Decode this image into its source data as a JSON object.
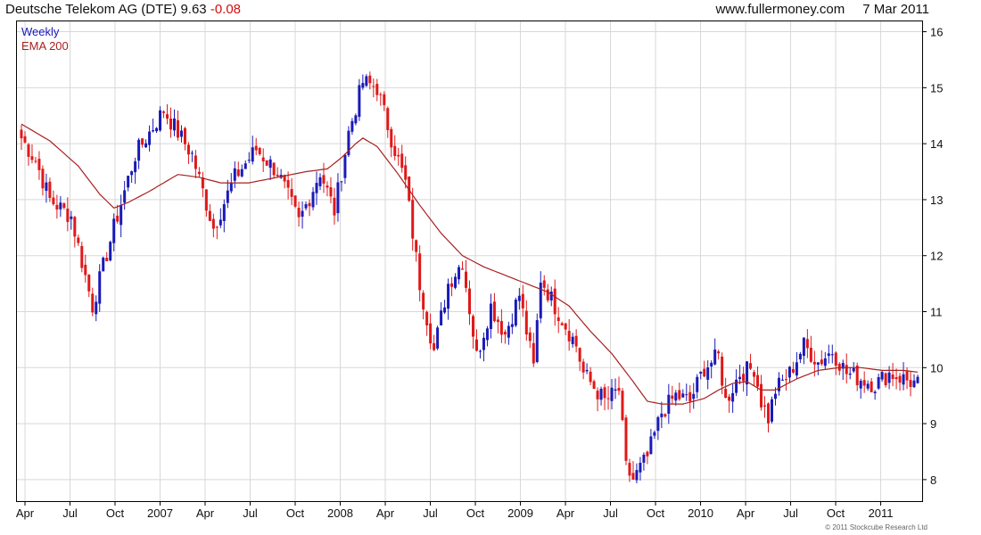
{
  "header": {
    "title_main": "Deutsche Telekom AG (DTE) 9.63",
    "title_change": "-0.08",
    "site": "www.fullermoney.com",
    "date": "7 Mar 2011"
  },
  "legend": {
    "series1": "Weekly",
    "series2": "EMA 200"
  },
  "footer": {
    "copyright": "© 2011 Stockcube Research Ltd"
  },
  "colors": {
    "up": "#1a1ab8",
    "down": "#e01818",
    "ema": "#a82020",
    "grid": "#d8d8d8"
  },
  "chart_data": {
    "type": "candlestick",
    "xlabels": [
      "Apr",
      "Jul",
      "Oct",
      "2007",
      "Apr",
      "Jul",
      "Oct",
      "2008",
      "Apr",
      "Jul",
      "Oct",
      "2009",
      "Apr",
      "Jul",
      "Oct",
      "2010",
      "Apr",
      "Jul",
      "Oct",
      "2011"
    ],
    "yticks": [
      8,
      9,
      10,
      11,
      12,
      13,
      14,
      15,
      16
    ],
    "ylim": [
      7.6,
      16.2
    ],
    "grid": true,
    "legend_position": "top-left",
    "series": [
      {
        "name": "Weekly",
        "type": "candlestick",
        "close_points": [
          [
            0,
            14.1
          ],
          [
            4,
            13.7
          ],
          [
            8,
            13.0
          ],
          [
            14,
            12.7
          ],
          [
            20,
            11.1
          ],
          [
            26,
            12.5
          ],
          [
            32,
            13.8
          ],
          [
            40,
            14.6
          ],
          [
            48,
            13.8
          ],
          [
            54,
            12.5
          ],
          [
            60,
            13.4
          ],
          [
            66,
            13.9
          ],
          [
            72,
            13.5
          ],
          [
            78,
            12.6
          ],
          [
            84,
            13.5
          ],
          [
            88,
            12.8
          ],
          [
            92,
            14.2
          ],
          [
            96,
            15.1
          ],
          [
            100,
            15.0
          ],
          [
            104,
            14.1
          ],
          [
            108,
            13.3
          ],
          [
            112,
            11.5
          ],
          [
            116,
            10.3
          ],
          [
            120,
            11.5
          ],
          [
            124,
            11.9
          ],
          [
            128,
            10.2
          ],
          [
            132,
            11.1
          ],
          [
            136,
            10.6
          ],
          [
            140,
            11.3
          ],
          [
            144,
            10.0
          ],
          [
            146,
            11.6
          ],
          [
            150,
            11.1
          ],
          [
            156,
            10.4
          ],
          [
            158,
            9.9
          ],
          [
            164,
            9.4
          ],
          [
            168,
            9.6
          ],
          [
            170,
            8.2
          ],
          [
            172,
            8.0
          ],
          [
            176,
            8.4
          ],
          [
            180,
            9.2
          ],
          [
            184,
            9.5
          ],
          [
            188,
            9.4
          ],
          [
            192,
            10.0
          ],
          [
            196,
            10.2
          ],
          [
            198,
            9.4
          ],
          [
            202,
            9.9
          ],
          [
            206,
            10.0
          ],
          [
            208,
            9.4
          ],
          [
            210,
            9.1
          ],
          [
            212,
            9.6
          ],
          [
            216,
            9.9
          ],
          [
            220,
            10.4
          ],
          [
            224,
            10.1
          ],
          [
            228,
            10.3
          ],
          [
            232,
            9.9
          ],
          [
            236,
            9.8
          ],
          [
            240,
            9.7
          ],
          [
            244,
            9.9
          ],
          [
            248,
            9.8
          ],
          [
            252,
            9.7
          ]
        ],
        "note": "close_points = [week index, approx close]"
      },
      {
        "name": "EMA 200",
        "type": "line",
        "points": [
          [
            0,
            14.35
          ],
          [
            8,
            14.05
          ],
          [
            16,
            13.6
          ],
          [
            22,
            13.1
          ],
          [
            26,
            12.85
          ],
          [
            30,
            12.95
          ],
          [
            36,
            13.15
          ],
          [
            44,
            13.45
          ],
          [
            50,
            13.4
          ],
          [
            56,
            13.3
          ],
          [
            64,
            13.3
          ],
          [
            72,
            13.4
          ],
          [
            80,
            13.5
          ],
          [
            86,
            13.55
          ],
          [
            90,
            13.75
          ],
          [
            94,
            14.0
          ],
          [
            96,
            14.1
          ],
          [
            100,
            13.95
          ],
          [
            106,
            13.45
          ],
          [
            112,
            12.9
          ],
          [
            118,
            12.4
          ],
          [
            124,
            12.0
          ],
          [
            130,
            11.8
          ],
          [
            136,
            11.65
          ],
          [
            142,
            11.5
          ],
          [
            148,
            11.35
          ],
          [
            154,
            11.1
          ],
          [
            160,
            10.65
          ],
          [
            166,
            10.25
          ],
          [
            172,
            9.75
          ],
          [
            176,
            9.4
          ],
          [
            180,
            9.35
          ],
          [
            186,
            9.35
          ],
          [
            192,
            9.45
          ],
          [
            196,
            9.6
          ],
          [
            200,
            9.72
          ],
          [
            204,
            9.75
          ],
          [
            208,
            9.6
          ],
          [
            212,
            9.6
          ],
          [
            218,
            9.8
          ],
          [
            224,
            9.95
          ],
          [
            230,
            10.0
          ],
          [
            236,
            10.0
          ],
          [
            242,
            9.95
          ],
          [
            248,
            9.95
          ],
          [
            252,
            9.92
          ]
        ]
      }
    ]
  }
}
